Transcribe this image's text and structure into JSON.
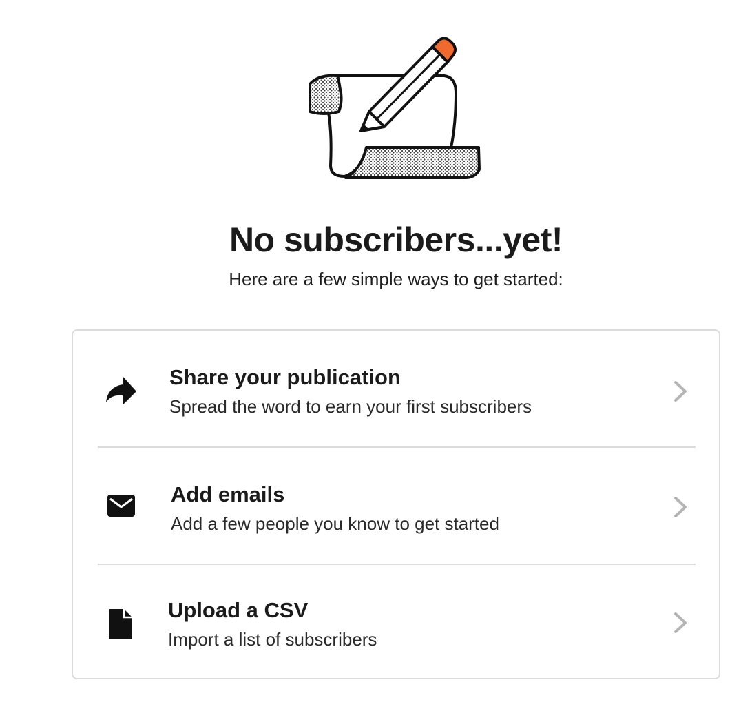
{
  "empty_state": {
    "title": "No subscribers...yet!",
    "subtitle": "Here are a few simple ways to get started:",
    "illustration": "scroll-and-pencil-illustration"
  },
  "options": [
    {
      "label": "Share your publication",
      "description": "Spread the word to earn your first subscribers",
      "icon": "share-arrow-icon"
    },
    {
      "label": "Add emails",
      "description": "Add a few people you know to get started",
      "icon": "envelope-icon"
    },
    {
      "label": "Upload a CSV",
      "description": "Import a list of subscribers",
      "icon": "file-icon"
    }
  ],
  "colors": {
    "text": "#1b1b1b",
    "border": "#dcdcdc",
    "chevron": "#b5b5b5",
    "pencil_tip": "#f06a2e"
  }
}
